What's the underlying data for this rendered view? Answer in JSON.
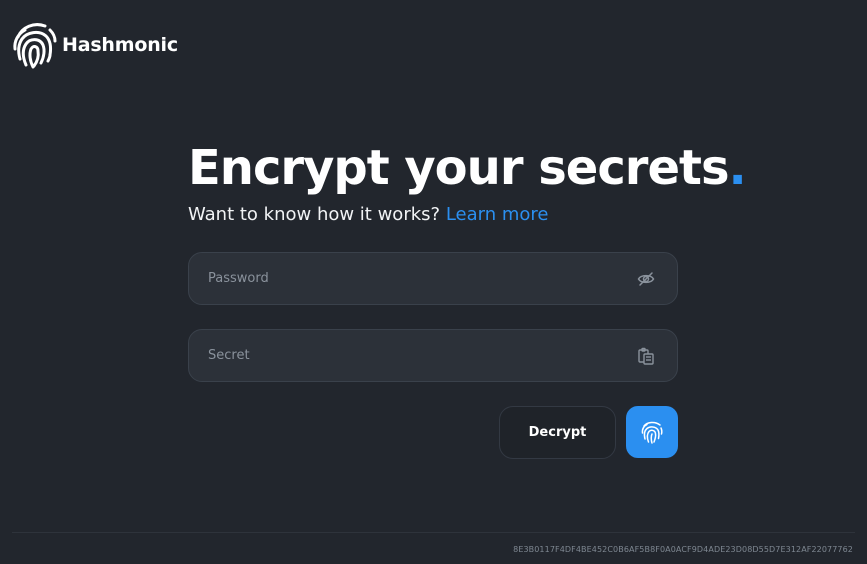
{
  "app": {
    "name": "Hashmonic",
    "logo_icon": "fingerprint-icon"
  },
  "hero": {
    "headline": "Encrypt your secrets",
    "headline_dot": ".",
    "subline_prefix": "Want to know how it works?",
    "learn_more_label": "Learn more"
  },
  "form": {
    "password": {
      "placeholder": "Password",
      "value": "",
      "toggle_icon": "eye-slash-icon"
    },
    "secret": {
      "placeholder": "Secret",
      "value": "",
      "paste_icon": "clipboard-icon"
    },
    "decrypt_label": "Decrypt",
    "encrypt_icon": "fingerprint-icon"
  },
  "footer": {
    "hash": "8E3B0117F4DF4BE452C0B6AF5B8F0A0ACF9D4ADE23D08D55D7E312AF22077762"
  },
  "colors": {
    "background": "#22262d",
    "accent": "#2b8ff0",
    "field_bg": "#2c3139",
    "muted_text": "#8a929c"
  }
}
